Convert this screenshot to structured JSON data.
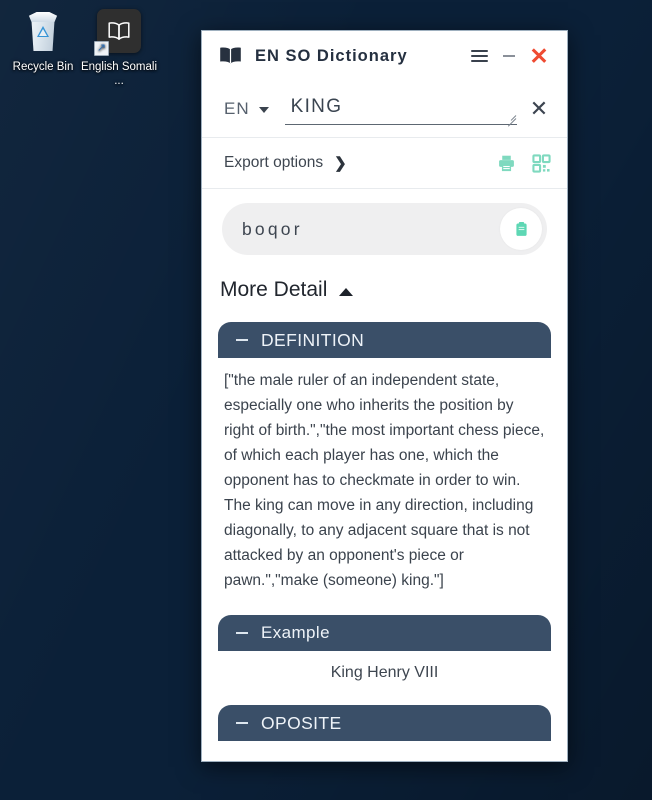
{
  "desktop": {
    "icons": [
      {
        "name": "recycle-bin",
        "label": "Recycle Bin",
        "icon": "recycle-bin-icon"
      },
      {
        "name": "english-somali-dictionary",
        "label": "English Somali ...",
        "icon": "book-app-icon"
      }
    ]
  },
  "window": {
    "title": "EN SO Dictionary",
    "icon": "book-icon",
    "controls": {
      "menu_label": "☰",
      "menu_icon": "hamburger-menu-icon",
      "minimize_label": "–",
      "minimize_icon": "minimize-icon",
      "close_label": "✕",
      "close_icon": "close-icon"
    }
  },
  "search": {
    "language_code": "EN",
    "dropdown_icon": "chevron-down-icon",
    "query": "KING",
    "placeholder": "",
    "clear_label": "✕",
    "clear_icon": "clear-icon",
    "resize_icon": "resize-grip-icon"
  },
  "export": {
    "label": "Export options",
    "caret": "❯",
    "caret_icon": "chevron-right-icon",
    "print_icon": "printer-icon",
    "qr_icon": "qr-code-icon",
    "accent_color": "#7fd9bf"
  },
  "result": {
    "translation": "boqor",
    "copy_icon": "clipboard-copy-icon"
  },
  "more_detail": {
    "label": "More Detail",
    "toggle_icon": "chevron-up-icon",
    "expanded": true
  },
  "sections": [
    {
      "key": "definition",
      "title": "DEFINITION",
      "collapse_icon": "minus-icon",
      "body": "[\"the male ruler of an independent state, especially one who inherits the position by right of birth.\",\"the most important chess piece, of which each player has one, which the opponent has to checkmate in order to win. The king can move in any direction, including diagonally, to any adjacent square that is not attacked by an opponent's piece or pawn.\",\"make (someone) king.\"]",
      "centered": false
    },
    {
      "key": "example",
      "title": "Example",
      "collapse_icon": "minus-icon",
      "body": "King Henry VIII",
      "centered": true
    },
    {
      "key": "oposite",
      "title": "OPOSITE",
      "collapse_icon": "minus-icon",
      "body": "",
      "centered": false
    }
  ],
  "theme": {
    "section_header_bg": "#3a4f68",
    "close_red": "#ef4b32",
    "mint": "#7fd9bf",
    "desktop_bg": "#0b2038"
  }
}
